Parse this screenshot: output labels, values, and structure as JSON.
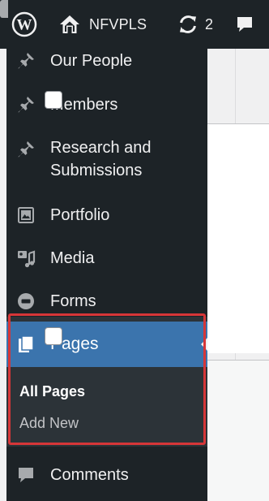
{
  "admin_bar": {
    "site_name": "NFVPLS",
    "updates_count": "2",
    "icons": {
      "wordpress": "wordpress-logo-icon",
      "site": "home-icon",
      "updates": "refresh-icon",
      "comments": "comment-bubble-icon"
    }
  },
  "sidebar": {
    "items": [
      {
        "label": "Our People",
        "icon": "pushpin-icon"
      },
      {
        "label": "Members",
        "icon": "pushpin-icon"
      },
      {
        "label": "Research and Submissions",
        "icon": "pushpin-icon"
      },
      {
        "label": "Portfolio",
        "icon": "portfolio-icon"
      },
      {
        "label": "Media",
        "icon": "media-icon"
      },
      {
        "label": "Forms",
        "icon": "forms-icon"
      },
      {
        "label": "Pages",
        "icon": "pages-icon",
        "active": true
      },
      {
        "label": "Comments",
        "icon": "comment-bubble-icon"
      }
    ],
    "pages_submenu": [
      {
        "label": "All Pages",
        "current": true
      },
      {
        "label": "Add New"
      }
    ]
  },
  "colors": {
    "admin_bar_bg": "#1d2327",
    "active_menu_bg": "#3b74ad",
    "submenu_bg": "#2c3338",
    "highlight_border": "#d63638"
  }
}
